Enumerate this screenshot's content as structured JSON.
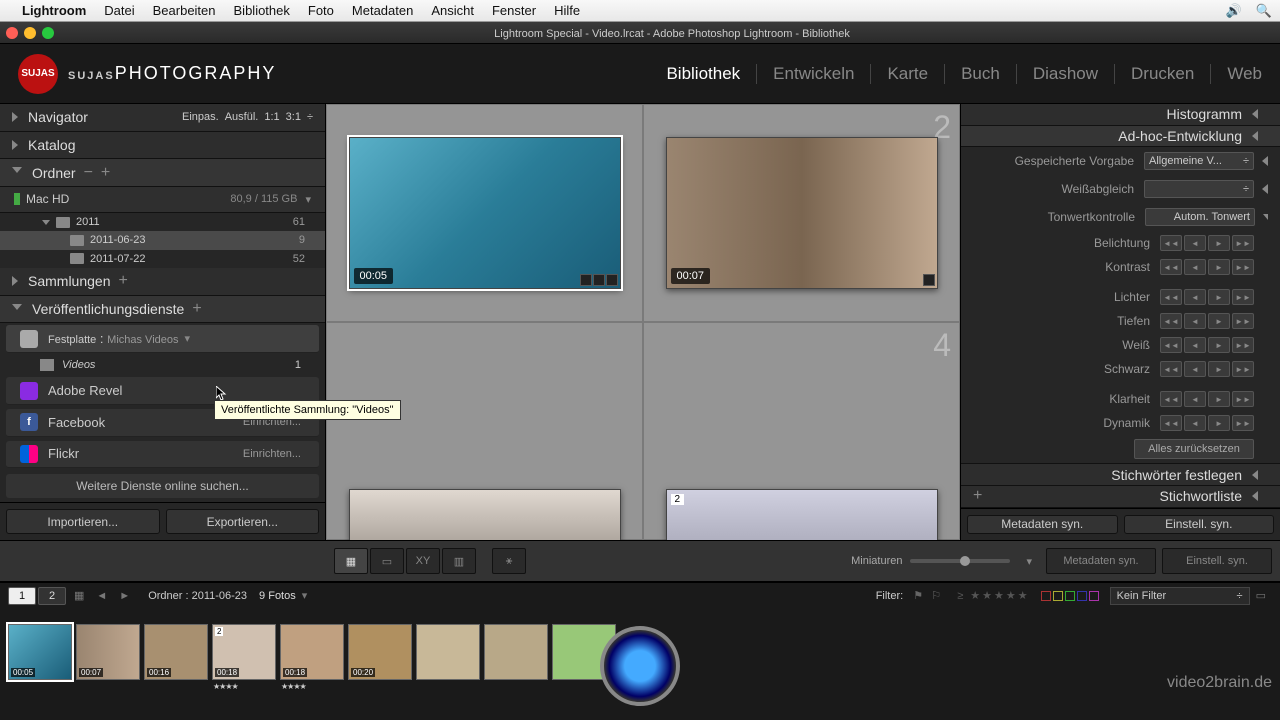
{
  "menubar": {
    "app": "Lightroom",
    "items": [
      "Datei",
      "Bearbeiten",
      "Bibliothek",
      "Foto",
      "Metadaten",
      "Ansicht",
      "Fenster",
      "Hilfe"
    ]
  },
  "window_title": "Lightroom Special - Video.lrcat - Adobe Photoshop Lightroom - Bibliothek",
  "logo_text": "SUJASPHOTOGRAPHY",
  "modules": [
    "Bibliothek",
    "Entwickeln",
    "Karte",
    "Buch",
    "Diashow",
    "Drucken",
    "Web"
  ],
  "active_module": "Bibliothek",
  "left": {
    "navigator": {
      "label": "Navigator",
      "meta": [
        "Einpas.",
        "Ausfül.",
        "1:1",
        "3:1"
      ]
    },
    "katalog": "Katalog",
    "ordner": "Ordner",
    "volume": {
      "name": "Mac HD",
      "size": "80,9 / 115 GB"
    },
    "folders": [
      {
        "name": "2011",
        "count": 61,
        "level": 1,
        "expanded": true
      },
      {
        "name": "2011-06-23",
        "count": 9,
        "level": 2,
        "selected": true
      },
      {
        "name": "2011-07-22",
        "count": 52,
        "level": 2
      }
    ],
    "sammlungen": "Sammlungen",
    "pub": {
      "label": "Veröffentlichungsdienste",
      "services": [
        {
          "type": "Festplatte",
          "name": "Michas Videos",
          "sub": {
            "name": "Videos",
            "count": 1
          }
        },
        {
          "type": "Adobe Revel",
          "color": "#8a2be2"
        },
        {
          "type": "Facebook",
          "action": "Einrichten...",
          "color": "#3b5998"
        },
        {
          "type": "Flickr",
          "action": "Einrichten...",
          "color": "#ff0084"
        }
      ],
      "more": "Weitere Dienste online suchen..."
    },
    "import": "Importieren...",
    "export": "Exportieren..."
  },
  "tooltip": "Veröffentlichte Sammlung: \"Videos\"",
  "grid": {
    "items": [
      {
        "time": "00:05",
        "selected": true,
        "bg": "linear-gradient(135deg,#4a9db8,#2a6d88,#1a4d68)"
      },
      {
        "time": "00:07",
        "bg": "linear-gradient(90deg,#8a7560,#6a5540,#b09880)"
      },
      {
        "bg": "linear-gradient(#ddd,#aaa)"
      },
      {
        "badge": "2",
        "bg": "linear-gradient(#c8c8d8,#a8a8b8)"
      }
    ]
  },
  "right": {
    "histogram": "Histogramm",
    "adhoc": "Ad-hoc-Entwicklung",
    "preset": {
      "label": "Gespeicherte Vorgabe",
      "value": "Allgemeine V..."
    },
    "wb": "Weißabgleich",
    "tone": {
      "label": "Tonwertkontrolle",
      "value": "Autom. Tonwert"
    },
    "sliders": [
      "Belichtung",
      "Kontrast",
      "Lichter",
      "Tiefen",
      "Weiß",
      "Schwarz",
      "Klarheit",
      "Dynamik"
    ],
    "reset": "Alles zurücksetzen",
    "keywords": "Stichwörter festlegen",
    "keywordlist": "Stichwortliste",
    "syncmeta": "Metadaten syn.",
    "syncset": "Einstell. syn."
  },
  "toolbar": {
    "thumbs": "Miniaturen"
  },
  "filterbar": {
    "tab1": "1",
    "tab2": "2",
    "path": "Ordner : 2011-06-23",
    "count": "9 Fotos",
    "filter": "Filter:",
    "nofilter": "Kein Filter"
  },
  "filmstrip": [
    {
      "t": "00:05",
      "sel": true
    },
    {
      "t": "00:07"
    },
    {
      "t": "00:16"
    },
    {
      "t": "00:18",
      "badge": "2",
      "stars": true
    },
    {
      "t": "00:18",
      "stars": true
    },
    {
      "t": "00:20"
    },
    {
      "t": ""
    },
    {
      "t": ""
    },
    {
      "t": ""
    }
  ],
  "watermark": "video2brain.de"
}
